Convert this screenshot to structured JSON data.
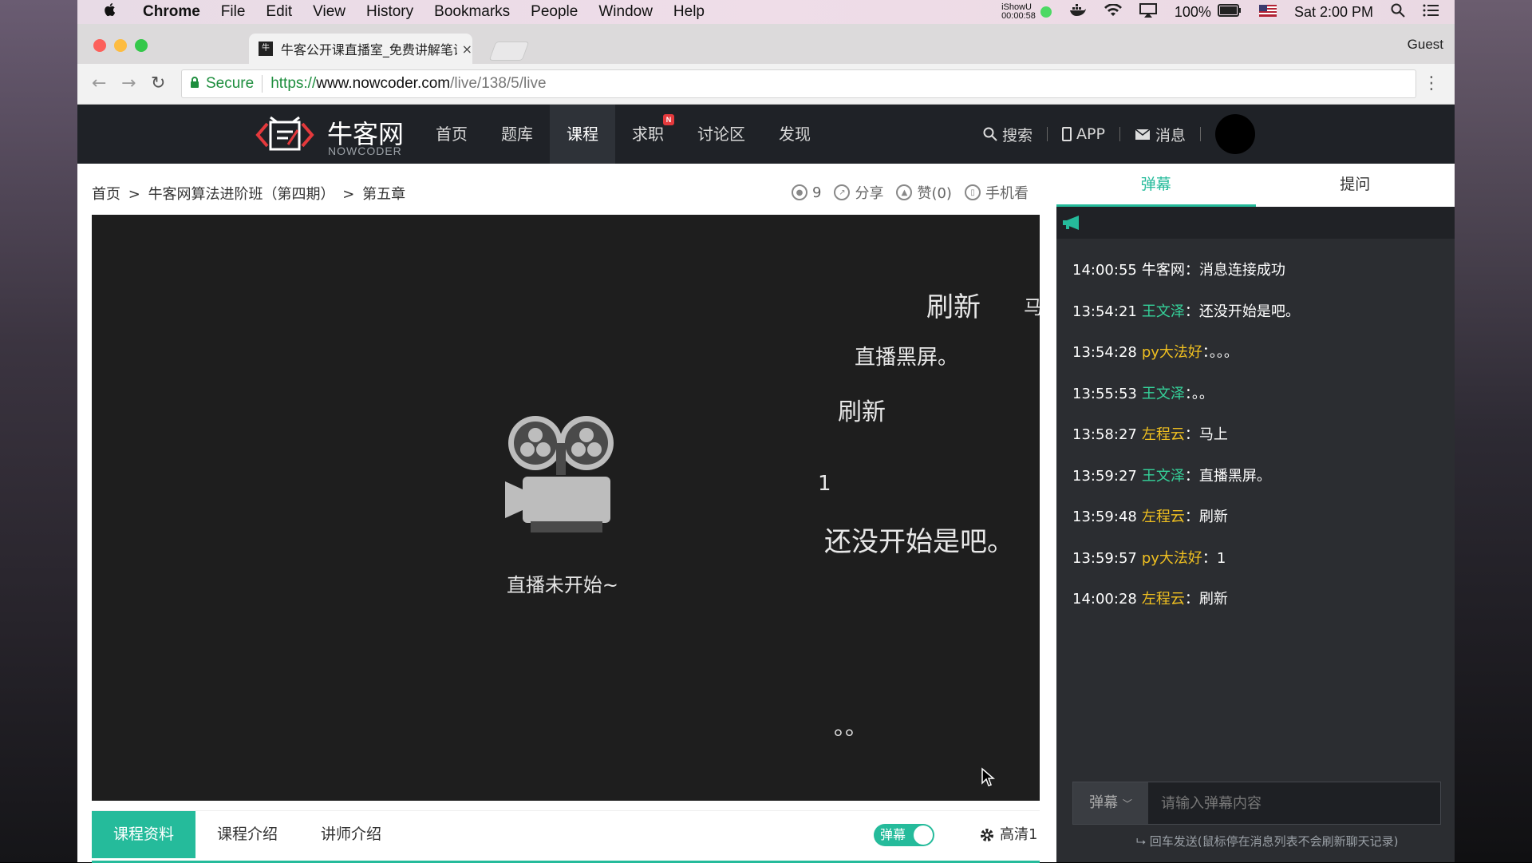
{
  "menubar": {
    "apple": "",
    "app": "Chrome",
    "items": [
      "File",
      "Edit",
      "View",
      "History",
      "Bookmarks",
      "People",
      "Window",
      "Help"
    ],
    "recorder_name": "iShowU",
    "recorder_time": "00:00:58",
    "battery": "100%",
    "clock": "Sat 2:00 PM"
  },
  "browser": {
    "tab_title": "牛客公开课直播室_免费讲解笔试",
    "tab_close": "×",
    "guest": "Guest",
    "secure_label": "Secure",
    "url_scheme": "https://",
    "url_host": "www.nowcoder.com",
    "url_path": "/live/138/5/live"
  },
  "site": {
    "logo_cn": "牛客网",
    "logo_en": "NOWCODER",
    "nav": [
      "首页",
      "题库",
      "课程",
      "求职",
      "讨论区",
      "发现"
    ],
    "nav_active": "课程",
    "nav_badge": "N",
    "search": "搜索",
    "app": "APP",
    "messages": "消息",
    "accent": "#25bb9b"
  },
  "breadcrumb": {
    "home": "首页",
    "sep1": ">",
    "course": "牛客网算法进阶班（第四期）",
    "sep2": ">",
    "chapter": "第五章"
  },
  "actions": {
    "viewers": "9",
    "share": "分享",
    "like": "赞(0)",
    "mobile": "手机看"
  },
  "player": {
    "status": "直播未开始~",
    "danmaku": [
      {
        "text": "刷新"
      },
      {
        "text": "马"
      },
      {
        "text": "直播黑屏。"
      },
      {
        "text": "刷新"
      },
      {
        "text": "1"
      },
      {
        "text": "还没开始是吧。"
      },
      {
        "text": "。。"
      }
    ]
  },
  "bottom": {
    "tabs": [
      "课程资料",
      "课程介绍",
      "讲师介绍"
    ],
    "toggle": "弹幕",
    "quality": "高清1"
  },
  "panel": {
    "tabs": [
      "弹幕",
      "提问"
    ],
    "messages": [
      {
        "time": "14:00:55",
        "user": "牛客网",
        "text": "消息连接成功",
        "color": "#ffffff"
      },
      {
        "time": "13:54:21",
        "user": "王文泽",
        "text": "还没开始是吧。",
        "color": "#35d29a"
      },
      {
        "time": "13:54:28",
        "user": "py大法好",
        "text": "。。。",
        "color": "#f0c020"
      },
      {
        "time": "13:55:53",
        "user": "王文泽",
        "text": "。。",
        "color": "#35d29a"
      },
      {
        "time": "13:58:27",
        "user": "左程云",
        "text": "马上",
        "color": "#f0c020"
      },
      {
        "time": "13:59:27",
        "user": "王文泽",
        "text": "直播黑屏。",
        "color": "#35d29a"
      },
      {
        "time": "13:59:48",
        "user": "左程云",
        "text": "刷新",
        "color": "#f0c020"
      },
      {
        "time": "13:59:57",
        "user": "py大法好",
        "text": "1",
        "color": "#f0c020"
      },
      {
        "time": "14:00:28",
        "user": "左程云",
        "text": "刷新",
        "color": "#f0c020"
      }
    ],
    "colon": "：",
    "select_label": "弹幕",
    "input_placeholder": "请输入弹幕内容",
    "hint": "回车发送(鼠标停在消息列表不会刷新聊天记录)"
  }
}
